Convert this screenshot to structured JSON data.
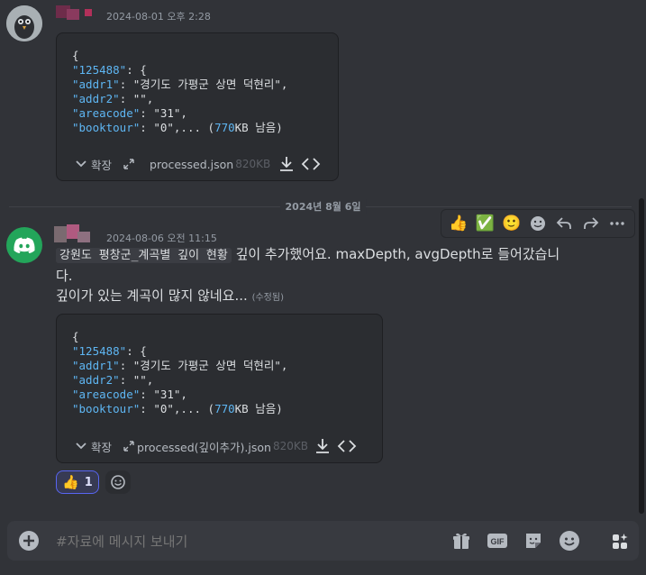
{
  "messages": [
    {
      "timestamp": "2024-08-01 오후 2:28",
      "attachment": {
        "code_lines": [
          [
            "{",
            ""
          ],
          [
            "\"125488\": {",
            "k"
          ],
          [
            "\"addr1\": \"경기도 가평군 상면 덕현리\",",
            "kv"
          ],
          [
            "\"addr2\": \"\",",
            "kv"
          ],
          [
            "\"areacode\": \"31\",",
            "kv"
          ],
          [
            "\"booktour\": \"0\",... (770KB 남음)",
            "kv"
          ]
        ],
        "line1": "{",
        "line2_key": "\"125488\"",
        "line2_rest": ": {",
        "line3_key": "\"addr1\"",
        "line3_val": ": \"경기도 가평군 상면 덕현리\",",
        "line4_key": "\"addr2\"",
        "line4_val": ": \"\",",
        "line5_key": "\"areacode\"",
        "line5_val": ": \"31\",",
        "line6_key": "\"booktour\"",
        "line6_val": ": \"0\",... (",
        "line6_num": "770",
        "line6_tail": "KB 남음)",
        "expand_label": "확장",
        "filename": "processed.json",
        "filesize": "820KB"
      }
    },
    {
      "timestamp": "2024-08-06 오전 11:15",
      "mention": "강원도 평창군_계곡별 깊이 현황",
      "text_line1": " 깊이 추가했어요. maxDepth, avgDepth로 들어갔습니",
      "text_line2": "다.",
      "text_line3": "깊이가 있는 계곡이 많지 않네요...",
      "edited": "(수정됨)",
      "attachment": {
        "line1": "{",
        "line2_key": "\"125488\"",
        "line2_rest": ": {",
        "line3_key": "\"addr1\"",
        "line3_val": ": \"경기도 가평군 상면 덕현리\",",
        "line4_key": "\"addr2\"",
        "line4_val": ": \"\",",
        "line5_key": "\"areacode\"",
        "line5_val": ": \"31\",",
        "line6_key": "\"booktour\"",
        "line6_val": ": \"0\",... (",
        "line6_num": "770",
        "line6_tail": "KB 남음)",
        "expand_label": "확장",
        "filename": "processed(깊이추가).json",
        "filesize": "820KB"
      },
      "reaction": {
        "emoji": "👍",
        "count": "1"
      }
    }
  ],
  "divider": {
    "label": "2024년 8월 6일"
  },
  "hover_bar": {
    "emojis": [
      "👍",
      "✅",
      "🙂"
    ]
  },
  "composer": {
    "placeholder": "#자료에 메시지 보내기"
  },
  "colors": {
    "accent": "#5865f2",
    "discord_green": "#23a55a",
    "key_blue": "#5eb6f3"
  }
}
